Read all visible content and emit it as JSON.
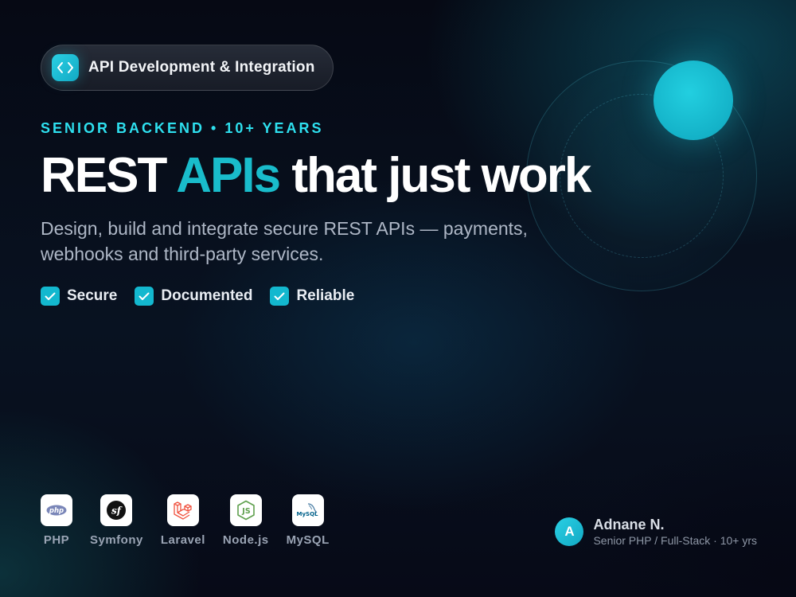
{
  "badge": {
    "label": "API Development & Integration",
    "icon": "code-icon"
  },
  "eyebrow": "SENIOR BACKEND • 10+ YEARS",
  "headline": {
    "part1": "REST ",
    "accent": "APIs",
    "part2": " that just work"
  },
  "subtitle": "Design, build and integrate secure REST APIs — payments, webhooks and third-party services.",
  "features": [
    {
      "label": "Secure",
      "icon": "check-icon"
    },
    {
      "label": "Documented",
      "icon": "check-icon"
    },
    {
      "label": "Reliable",
      "icon": "check-icon"
    }
  ],
  "stack": [
    {
      "label": "PHP",
      "logo_text": "php",
      "icon": "php-logo-icon"
    },
    {
      "label": "Symfony",
      "logo_text": "sf",
      "icon": "symfony-logo-icon"
    },
    {
      "label": "Laravel",
      "icon": "laravel-logo-icon"
    },
    {
      "label": "Node.js",
      "logo_text": "JS",
      "icon": "nodejs-logo-icon"
    },
    {
      "label": "MySQL",
      "logo_text": "MySQL",
      "icon": "mysql-logo-icon"
    }
  ],
  "author": {
    "initial": "A",
    "name": "Adnane N.",
    "role": "Senior PHP / Full-Stack · 10+ yrs"
  },
  "colors": {
    "accent": "#19bccb",
    "eyebrow": "#2ee0ef",
    "background": "#070a16"
  }
}
